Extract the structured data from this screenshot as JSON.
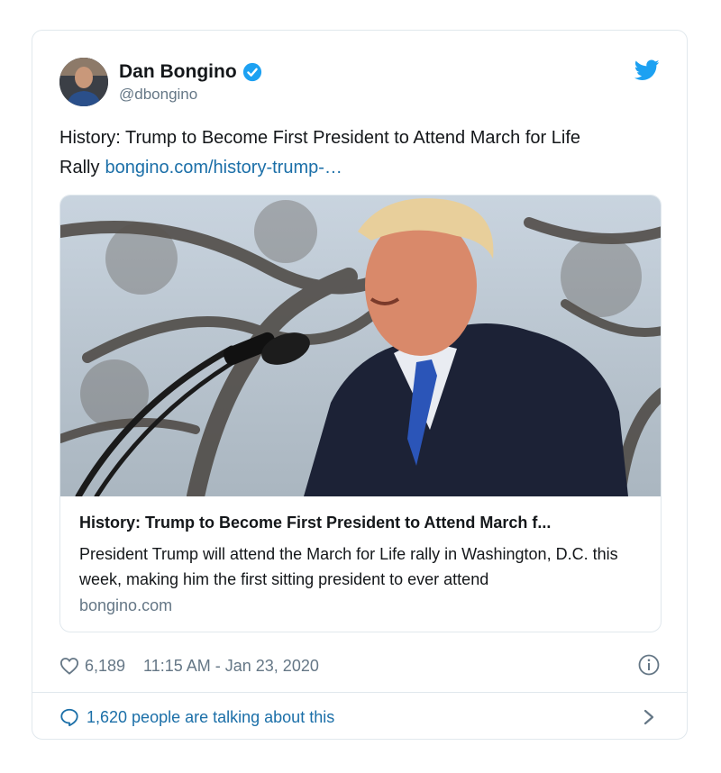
{
  "tweet": {
    "author_name": "Dan Bongino",
    "author_handle": "@dbongino",
    "text": "History: Trump to Become First President to Attend March for Life Rally",
    "link_text": "bongino.com/history-trump-…",
    "link_card": {
      "title": "History: Trump to Become First President to Attend March f...",
      "description": "President Trump will attend the March for Life rally in Washington, D.C. this week, making him the first sitting president to ever attend",
      "domain": "bongino.com"
    },
    "likes": "6,189",
    "timestamp": "11:15 AM - Jan 23, 2020",
    "talking": "1,620 people are talking about this"
  },
  "icons": {
    "verified": "verified-badge-icon",
    "brand": "twitter-bird-icon",
    "like": "heart-icon",
    "info": "info-icon",
    "reply": "speech-bubble-icon",
    "more": "chevron-right-icon"
  },
  "colors": {
    "brand_blue": "#1da1f2",
    "link": "#1b6fa8",
    "muted": "#657786",
    "border": "#e1e8ed"
  }
}
